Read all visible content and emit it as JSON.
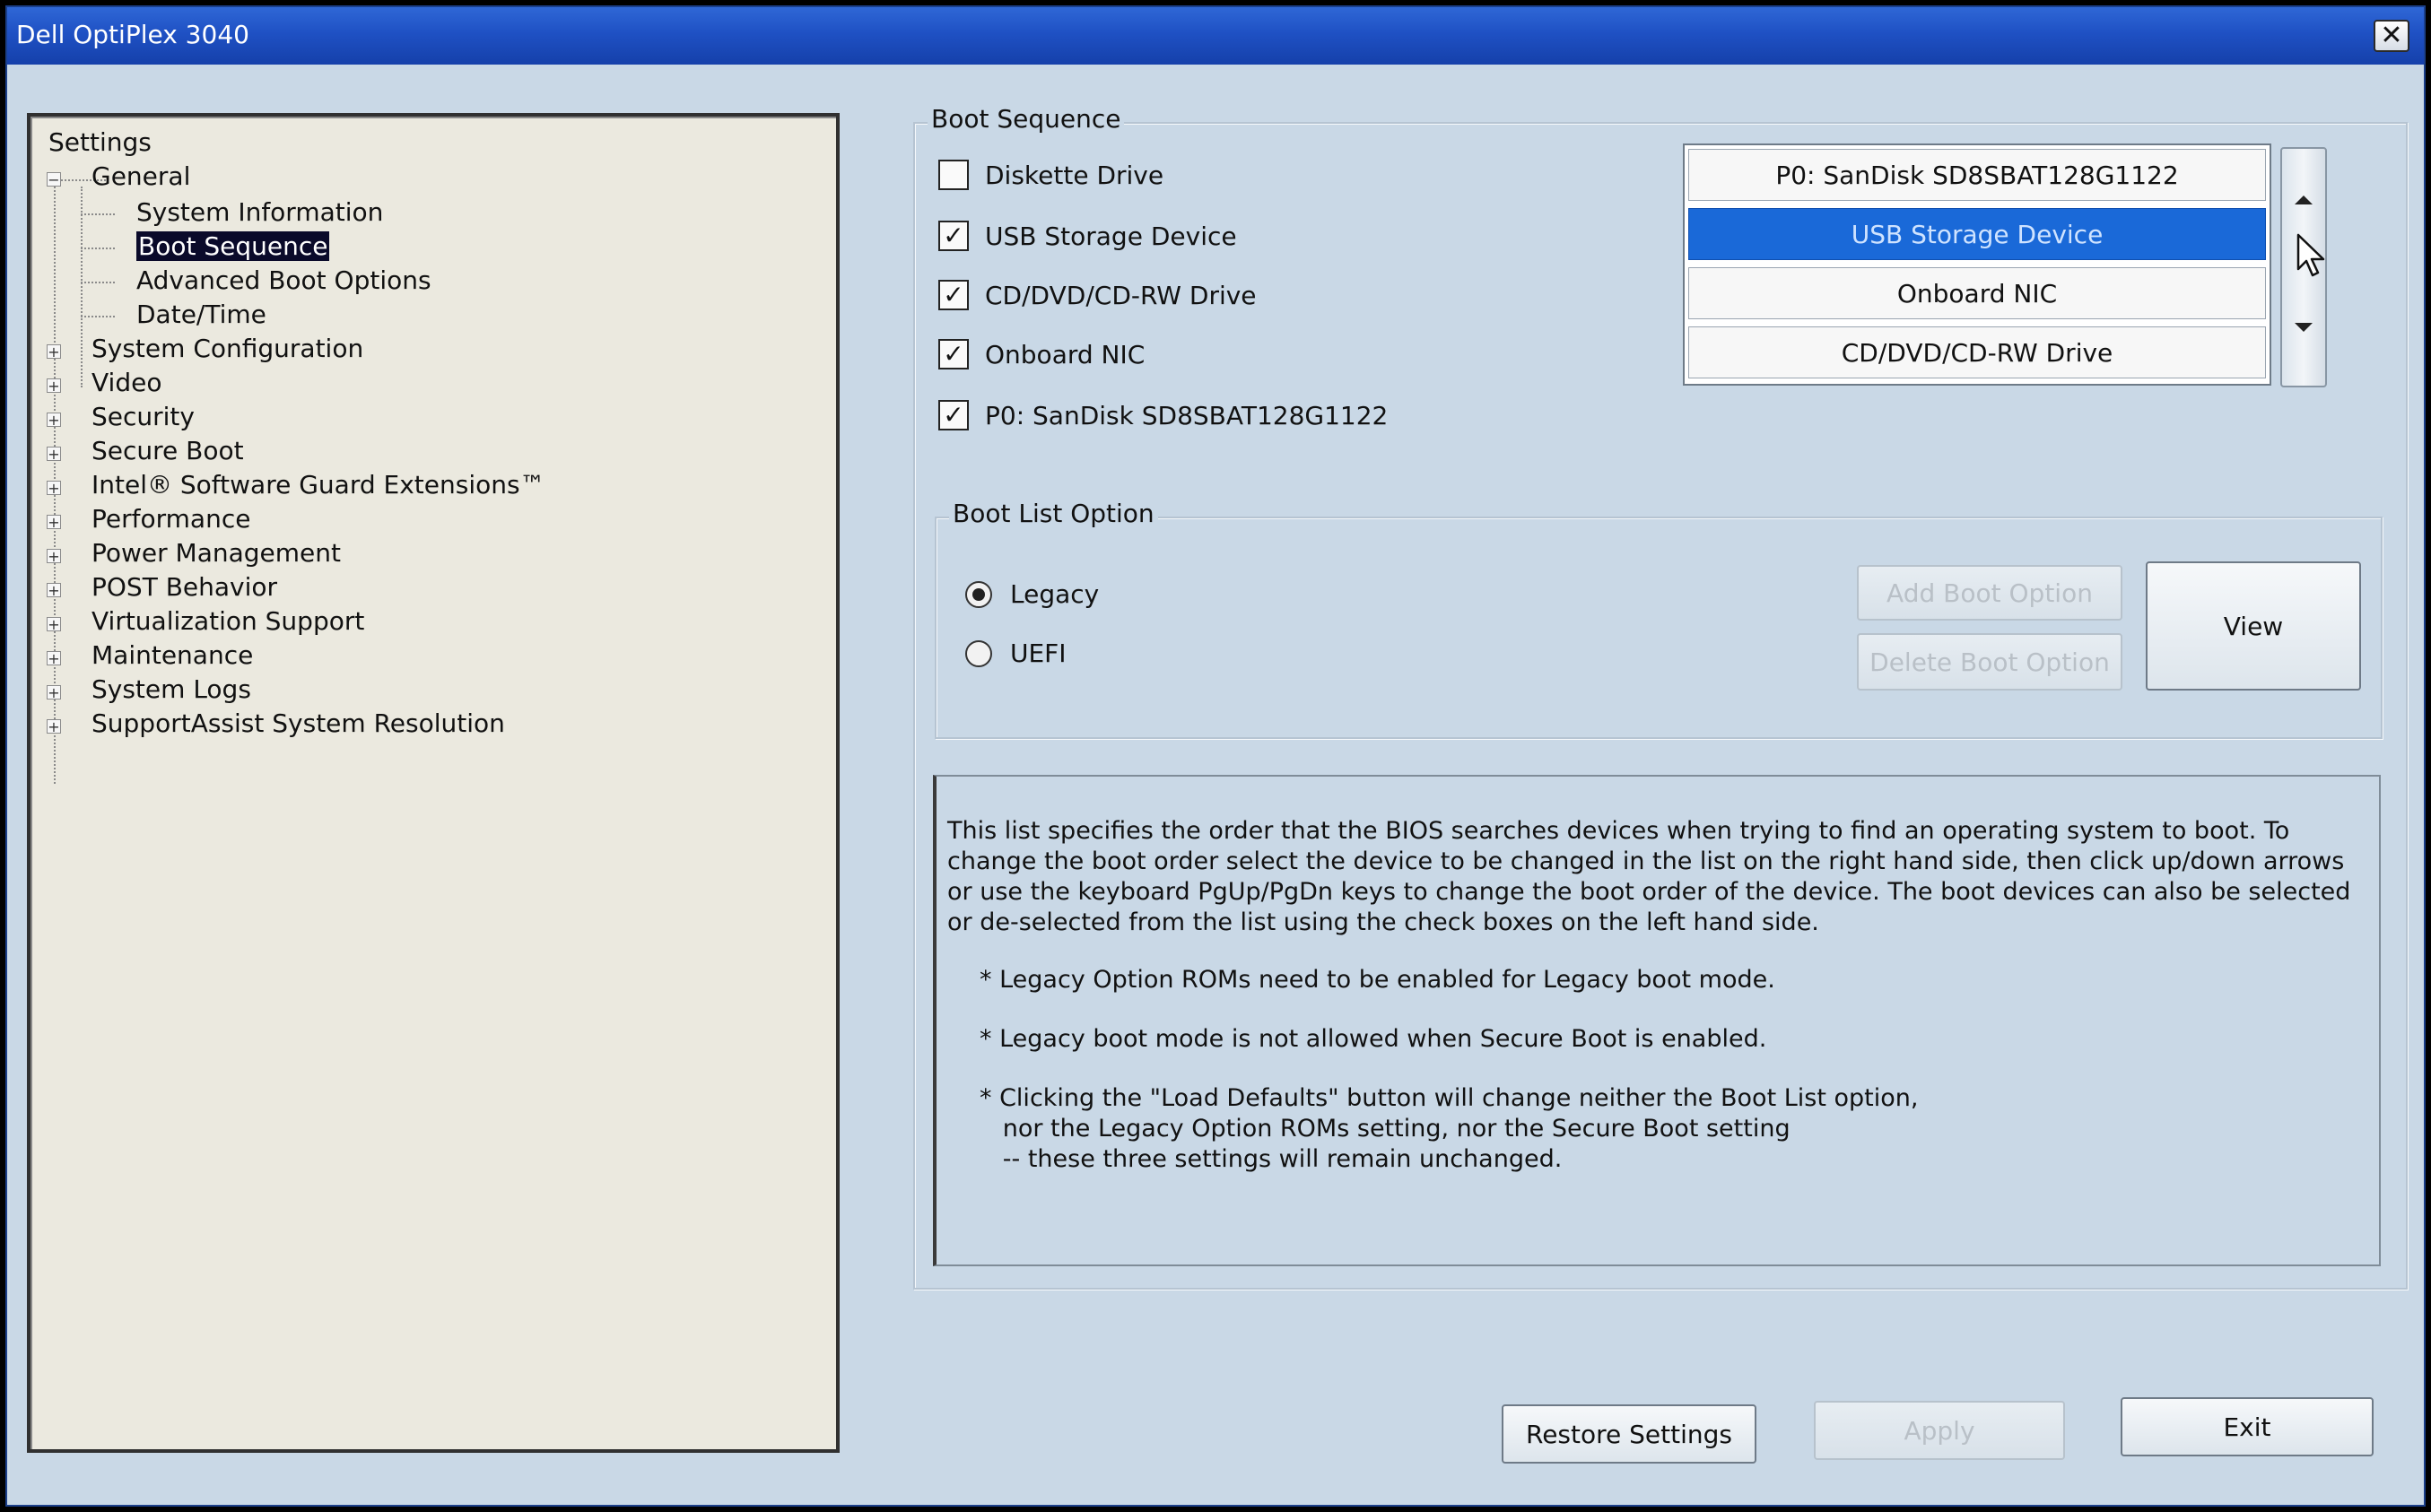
{
  "window": {
    "title": "Dell OptiPlex 3040",
    "close_glyph": "✕"
  },
  "tree": {
    "root": "Settings",
    "general": {
      "label": "General",
      "children": [
        "System Information",
        "Boot Sequence",
        "Advanced Boot Options",
        "Date/Time"
      ],
      "selected": "Boot Sequence"
    },
    "groups": [
      "System Configuration",
      "Video",
      "Security",
      "Secure Boot",
      "Intel® Software Guard Extensions™",
      "Performance",
      "Power Management",
      "POST Behavior",
      "Virtualization Support",
      "Maintenance",
      "System Logs",
      "SupportAssist System Resolution"
    ],
    "expand_glyph": "+",
    "collapse_glyph": "−"
  },
  "boot_sequence": {
    "legend": "Boot Sequence",
    "devices": [
      {
        "label": "Diskette Drive",
        "checked": false
      },
      {
        "label": "USB Storage Device",
        "checked": true
      },
      {
        "label": "CD/DVD/CD-RW Drive",
        "checked": true
      },
      {
        "label": "Onboard NIC",
        "checked": true
      },
      {
        "label": "P0: SanDisk SD8SBAT128G1122",
        "checked": true
      }
    ],
    "check_glyph": "✓",
    "order": [
      "P0: SanDisk SD8SBAT128G1122",
      "USB Storage Device",
      "Onboard NIC",
      "CD/DVD/CD-RW Drive"
    ],
    "selected_item": "USB Storage Device"
  },
  "boot_list_option": {
    "legend": "Boot List Option",
    "options": [
      "Legacy",
      "UEFI"
    ],
    "selected": "Legacy",
    "add_button": "Add Boot Option",
    "delete_button": "Delete Boot Option",
    "view_button": "View"
  },
  "description": {
    "paragraph": "This list specifies the order that the BIOS searches devices when trying to find an operating system to boot. To change the boot order select the device to be changed in the list on the right hand side, then click up/down arrows or use the keyboard PgUp/PgDn keys to change the boot order of the device. The boot devices can also be selected or de-selected from the list using the check boxes on the left hand side.",
    "bullets": [
      "* Legacy Option ROMs need to be enabled for Legacy boot mode.",
      "* Legacy boot mode is not allowed when Secure Boot is enabled.",
      "* Clicking the \"Load Defaults\" button will change neither the Boot List option,\n   nor the Legacy Option ROMs setting, nor the Secure Boot setting\n   -- these three settings will remain unchanged."
    ]
  },
  "footer": {
    "restore_button": "Restore Settings",
    "apply_button": "Apply",
    "exit_button": "Exit"
  },
  "colors": {
    "titlebar": "#1f51c4",
    "window_bg": "#c9d8e6",
    "tree_bg": "#ebe9df",
    "selection": "#1a69d8"
  }
}
